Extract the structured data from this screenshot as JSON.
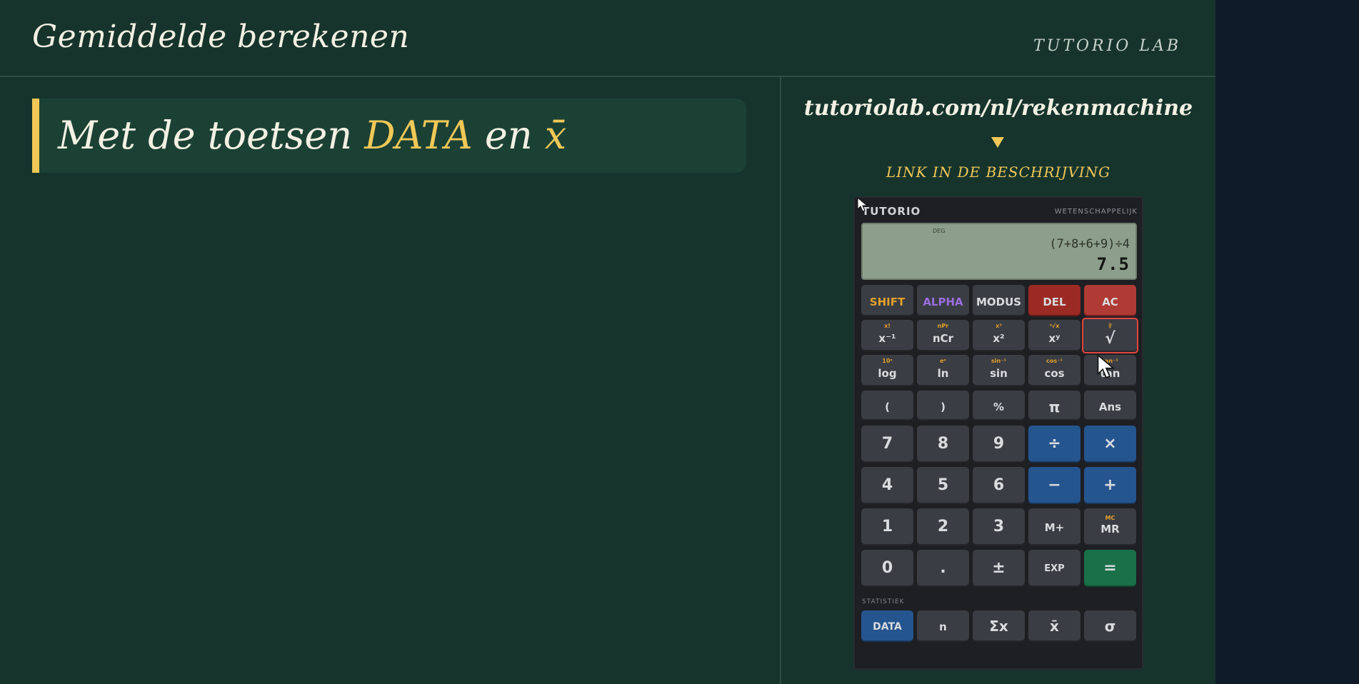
{
  "header": {
    "title": "Gemiddelde berekenen",
    "brand": "TUTORIO LAB"
  },
  "callout": {
    "prefix": "Met de toetsen ",
    "key1": "DATA",
    "middle": " en ",
    "key2": "x̄"
  },
  "sidebar": {
    "url": "tutoriolab.com/nl/rekenmachine",
    "link_note": "LINK IN DE BESCHRIJVING"
  },
  "calculator": {
    "brand": "TUTORIO",
    "mode_label": "WETENSCHAPPELIJK",
    "display": {
      "angle_mode": "DEG",
      "expression": "(7+8+6+9)÷4",
      "result": "7.5"
    },
    "row_top": [
      "SHIFT",
      "ALPHA",
      "MODUS",
      "DEL",
      "AC"
    ],
    "row_sci1": [
      {
        "sub": "x!",
        "main": "x⁻¹"
      },
      {
        "sub": "nPr",
        "main": "nCr"
      },
      {
        "sub": "x³",
        "main": "x²"
      },
      {
        "sub": "ˣ√x",
        "main": "xʸ"
      },
      {
        "sub": "∛",
        "main": "√"
      }
    ],
    "row_sci2": [
      {
        "sub": "10ˣ",
        "main": "log"
      },
      {
        "sub": "eˣ",
        "main": "ln"
      },
      {
        "sub": "sin⁻¹",
        "main": "sin"
      },
      {
        "sub": "cos⁻¹",
        "main": "cos"
      },
      {
        "sub": "tan⁻¹",
        "main": "tan"
      }
    ],
    "row_misc": [
      "(",
      ")",
      "%",
      "π",
      "Ans"
    ],
    "row_789": [
      "7",
      "8",
      "9",
      "÷",
      "×"
    ],
    "row_456": [
      "4",
      "5",
      "6",
      "−",
      "+"
    ],
    "row_123": [
      "1",
      "2",
      "3",
      "M+",
      "MR"
    ],
    "mr_sub": "MC",
    "row_0": [
      "0",
      ".",
      "±",
      "EXP",
      "="
    ],
    "stats_label": "STATISTIEK",
    "row_stats": [
      "DATA",
      "n",
      "Σx",
      "x̄",
      "σ"
    ]
  },
  "colors": {
    "board": "#16342c",
    "accent_yellow": "#f1c857",
    "key_blue": "#25558f",
    "key_green": "#1a7049",
    "key_red": "#b03a34"
  }
}
